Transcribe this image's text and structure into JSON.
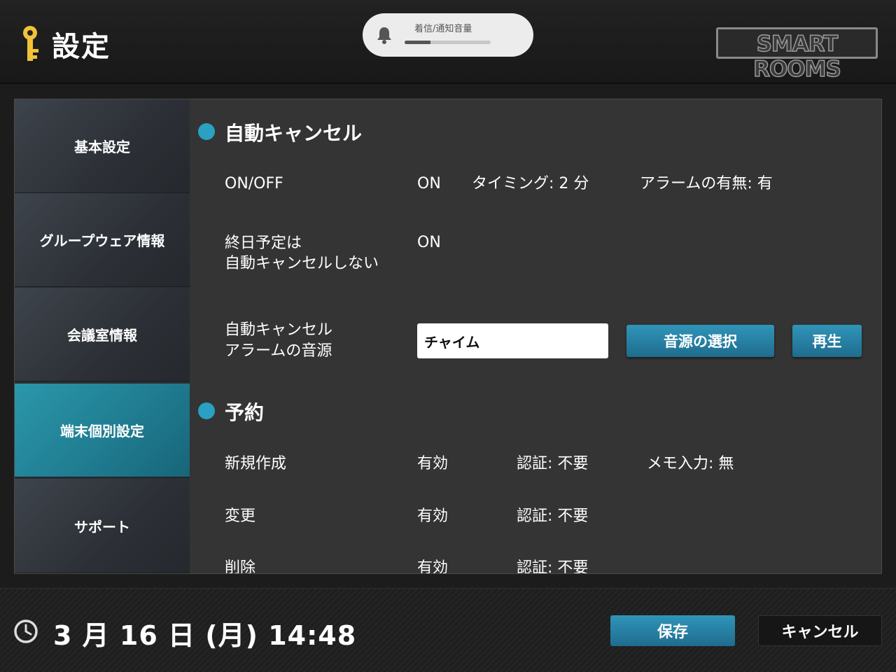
{
  "header": {
    "title": "設定",
    "key_icon": "key-icon",
    "volume": {
      "icon": "bell-icon",
      "label": "着信/通知音量",
      "level": 0.3
    },
    "logo_text": "SMART ROOMS"
  },
  "sidebar": {
    "items": [
      {
        "label": "基本設定",
        "active": false
      },
      {
        "label": "グループウェア情報",
        "active": false
      },
      {
        "label": "会議室情報",
        "active": false
      },
      {
        "label": "端末個別設定",
        "active": true
      },
      {
        "label": "サポート",
        "active": false
      }
    ]
  },
  "auto_cancel": {
    "title": "自動キャンセル",
    "onoff_label": "ON/OFF",
    "onoff_value": "ON",
    "timing": "タイミング: 2 分",
    "alarm": "アラームの有無: 有",
    "allday_label_1": "終日予定は",
    "allday_label_2": "自動キャンセルしない",
    "allday_value": "ON",
    "sound_label_1": "自動キャンセル",
    "sound_label_2": "アラームの音源",
    "sound_value": "チャイム",
    "select_button": "音源の選択",
    "play_button": "再生"
  },
  "reservation": {
    "title": "予約",
    "rows": [
      {
        "label": "新規作成",
        "status": "有効",
        "auth": "認証:  不要",
        "memo": "メモ入力: 無"
      },
      {
        "label": "変更",
        "status": "有効",
        "auth": "認証:  不要",
        "memo": ""
      },
      {
        "label": "削除",
        "status": "有効",
        "auth": "認証:  不要",
        "memo": ""
      }
    ]
  },
  "footer": {
    "clock_icon": "clock-icon",
    "datetime": "3 月 16 日 (月)  14:48",
    "save_label": "保存",
    "cancel_label": "キャンセル"
  },
  "colors": {
    "accent": "#2aa0c2",
    "active_tab": "#1f7a8f",
    "background": "#1c1c1c",
    "panel": "#343434"
  }
}
